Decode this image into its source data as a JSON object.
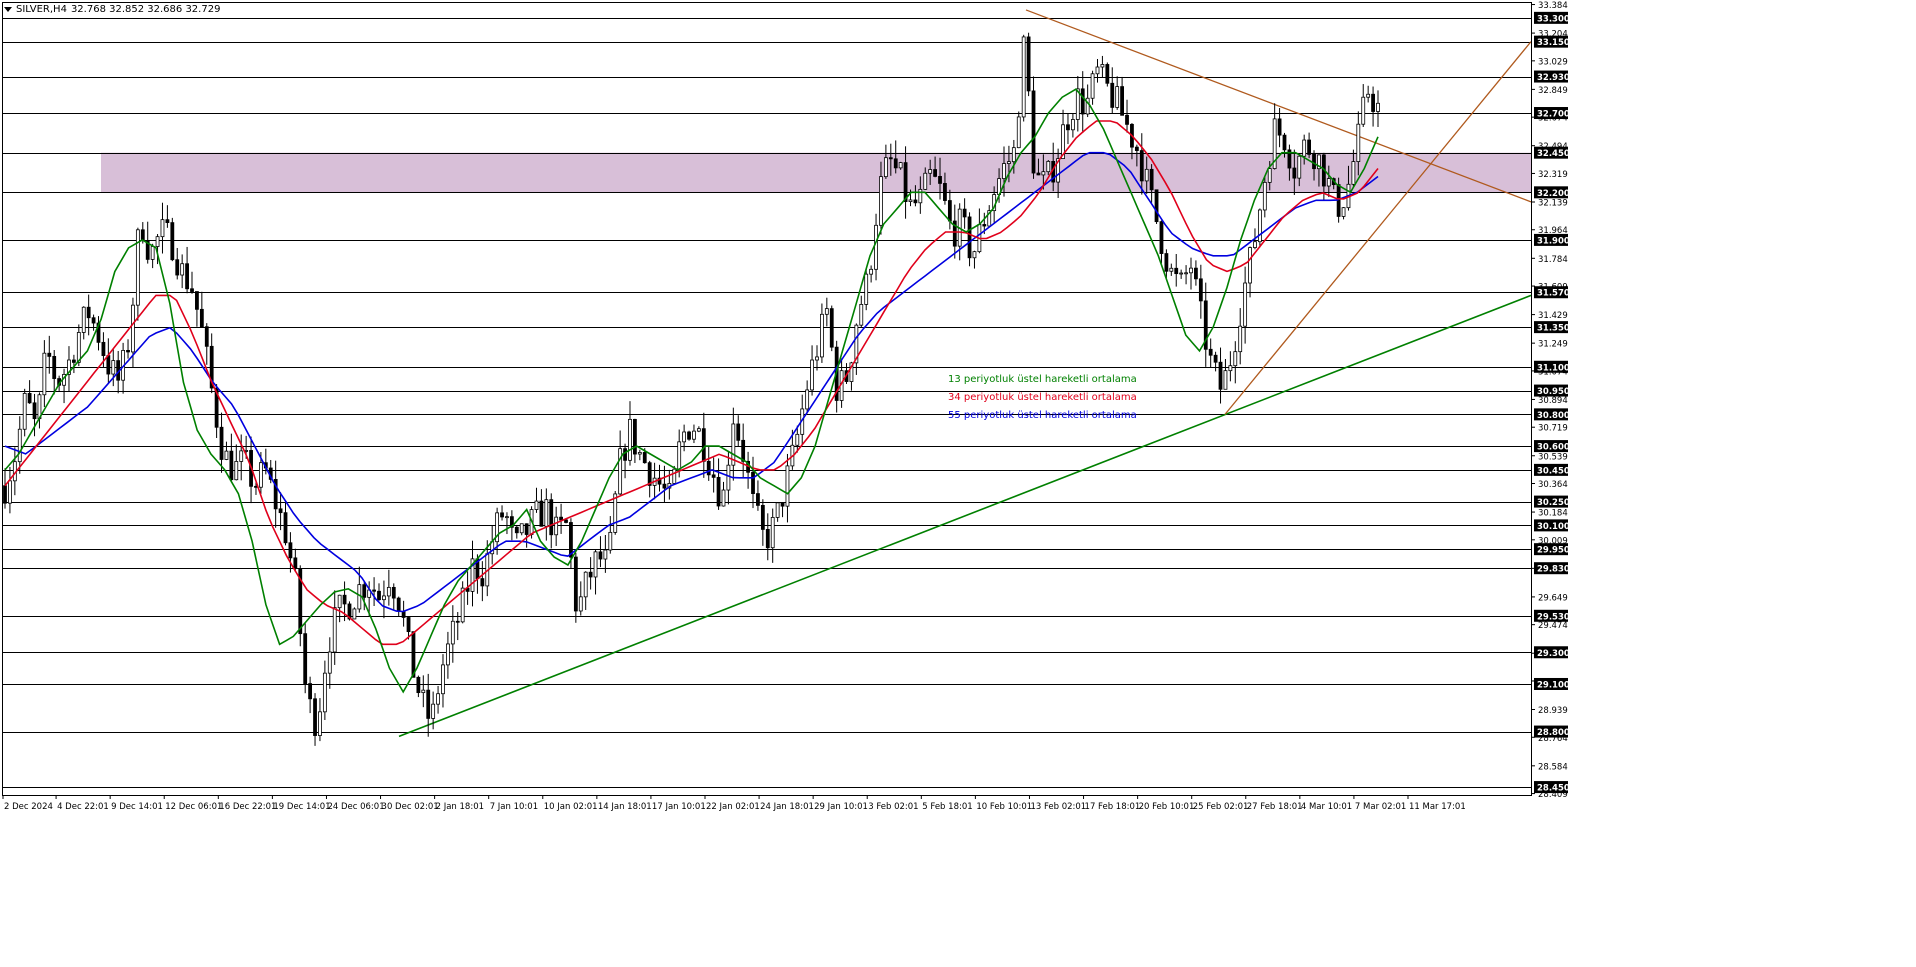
{
  "header": {
    "symbol": "SILVER,H4",
    "ohlc": "32.768 32.852 32.686 32.729"
  },
  "colors": {
    "ema13": "#008000",
    "ema34": "#e0001b",
    "ema55": "#0000e0",
    "support_trend": "#008000",
    "channel_trend": "#b05a1e",
    "zone_fill": "#d8bfd8",
    "hline": "#000000",
    "candle": "#000000"
  },
  "legend": [
    {
      "label": "13 periyotluk üstel hareketli ortalama",
      "color": "#008000"
    },
    {
      "label": "34 periyotluk üstel hareketli ortalama",
      "color": "#e0001b"
    },
    {
      "label": "55 periyotluk üstel hareketli ortalama",
      "color": "#0000e0"
    }
  ],
  "chart_data": {
    "type": "candlestick",
    "ylim": [
      28.4,
      33.4
    ],
    "y_ticks": [
      "33.384",
      "33.204",
      "33.029",
      "32.849",
      "32.674",
      "32.494",
      "32.319",
      "32.139",
      "31.964",
      "31.784",
      "31.609",
      "31.429",
      "31.249",
      "31.074",
      "30.894",
      "30.719",
      "30.539",
      "30.364",
      "30.184",
      "30.009",
      "29.829",
      "29.649",
      "29.474",
      "29.294",
      "29.119",
      "28.939",
      "28.764",
      "28.584",
      "28.409"
    ],
    "x_labels": [
      "2 Dec 2024",
      "4 Dec 22:01",
      "9 Dec 14:01",
      "12 Dec 06:01",
      "16 Dec 22:01",
      "19 Dec 14:01",
      "24 Dec 06:01",
      "30 Dec 02:01",
      "2 Jan 18:01",
      "7 Jan 10:01",
      "10 Jan 02:01",
      "14 Jan 18:01",
      "17 Jan 10:01",
      "22 Jan 02:01",
      "24 Jan 18:01",
      "29 Jan 10:01",
      "3 Feb 02:01",
      "5 Feb 18:01",
      "10 Feb 10:01",
      "13 Feb 02:01",
      "17 Feb 18:01",
      "20 Feb 10:01",
      "25 Feb 02:01",
      "27 Feb 18:01",
      "4 Mar 10:01",
      "7 Mar 02:01",
      "11 Mar 17:01"
    ],
    "price_levels": [
      "33.300",
      "33.150",
      "32.930",
      "32.700",
      "32.450",
      "32.200",
      "31.900",
      "31.570",
      "31.350",
      "31.100",
      "30.950",
      "30.800",
      "30.600",
      "30.450",
      "30.250",
      "30.100",
      "29.950",
      "29.830",
      "29.530",
      "29.300",
      "29.100",
      "28.800",
      "28.450"
    ],
    "zone": {
      "from": 32.2,
      "to": 32.45
    },
    "close_path": [
      30.35,
      30.55,
      30.9,
      30.7,
      31.2,
      31.0,
      31.1,
      31.3,
      31.45,
      31.3,
      31.1,
      31.0,
      31.3,
      32.05,
      31.8,
      31.95,
      31.9,
      31.7,
      31.6,
      31.3,
      30.9,
      30.55,
      30.45,
      30.5,
      30.35,
      30.45,
      30.25,
      30.05,
      29.7,
      29.0,
      28.85,
      29.35,
      29.55,
      29.6,
      29.7,
      29.75,
      29.65,
      29.8,
      29.6,
      29.25,
      29.0,
      28.85,
      29.2,
      29.4,
      29.6,
      29.85,
      29.8,
      30.05,
      30.2,
      29.95,
      30.05,
      30.15,
      30.2,
      30.05,
      30.1,
      29.55,
      29.75,
      29.9,
      29.85,
      30.45,
      30.7,
      30.55,
      30.45,
      30.35,
      30.25,
      30.65,
      30.75,
      30.65,
      30.45,
      30.25,
      30.8,
      30.55,
      30.2,
      30.0,
      30.1,
      30.35,
      30.6,
      30.95,
      31.2,
      31.45,
      30.95,
      31.05,
      31.45,
      31.65,
      32.2,
      32.4,
      32.3,
      32.1,
      32.15,
      32.3,
      32.2,
      31.95,
      32.0,
      31.8,
      32.0,
      32.2,
      32.35,
      32.45,
      33.15,
      32.3,
      32.25,
      32.4,
      32.65,
      32.8,
      32.75,
      32.95,
      32.85,
      32.75,
      32.6,
      32.45,
      32.2,
      31.95,
      31.7,
      31.6,
      31.75,
      31.4,
      31.1,
      30.95,
      31.2,
      31.55,
      31.85,
      32.25,
      32.6,
      32.55,
      32.35,
      32.5,
      32.45,
      32.3,
      32.1,
      32.2,
      32.5,
      32.85,
      32.73
    ],
    "ema13_path": [
      30.45,
      30.55,
      30.7,
      30.85,
      31.0,
      31.1,
      31.2,
      31.4,
      31.7,
      31.85,
      31.9,
      31.85,
      31.5,
      31.0,
      30.7,
      30.55,
      30.45,
      30.3,
      30.0,
      29.6,
      29.35,
      29.4,
      29.5,
      29.6,
      29.68,
      29.7,
      29.65,
      29.45,
      29.2,
      29.05,
      29.2,
      29.4,
      29.6,
      29.75,
      29.85,
      29.95,
      30.05,
      30.1,
      30.2,
      30.0,
      29.9,
      29.85,
      30.0,
      30.2,
      30.4,
      30.55,
      30.6,
      30.55,
      30.5,
      30.45,
      30.5,
      30.6,
      30.6,
      30.55,
      30.5,
      30.4,
      30.35,
      30.3,
      30.4,
      30.6,
      30.9,
      31.2,
      31.5,
      31.8,
      32.0,
      32.1,
      32.2,
      32.2,
      32.1,
      32.0,
      31.95,
      32.0,
      32.1,
      32.3,
      32.45,
      32.55,
      32.7,
      32.8,
      32.85,
      32.75,
      32.6,
      32.4,
      32.2,
      32.0,
      31.8,
      31.55,
      31.3,
      31.2,
      31.35,
      31.6,
      31.9,
      32.15,
      32.35,
      32.45,
      32.45,
      32.4,
      32.35,
      32.25,
      32.2,
      32.35,
      32.55
    ],
    "ema34_path": [
      30.35,
      30.5,
      30.65,
      30.8,
      30.95,
      31.1,
      31.25,
      31.4,
      31.55,
      31.55,
      31.3,
      31.0,
      30.75,
      30.5,
      30.15,
      29.9,
      29.7,
      29.6,
      29.55,
      29.45,
      29.35,
      29.35,
      29.45,
      29.55,
      29.65,
      29.75,
      29.85,
      29.95,
      30.05,
      30.1,
      30.15,
      30.2,
      30.25,
      30.3,
      30.35,
      30.4,
      30.45,
      30.5,
      30.55,
      30.5,
      30.45,
      30.45,
      30.55,
      30.7,
      30.9,
      31.1,
      31.3,
      31.5,
      31.7,
      31.85,
      31.95,
      31.95,
      31.9,
      31.95,
      32.05,
      32.2,
      32.4,
      32.55,
      32.65,
      32.65,
      32.55,
      32.4,
      32.2,
      31.95,
      31.75,
      31.7,
      31.75,
      31.9,
      32.05,
      32.15,
      32.2,
      32.15,
      32.2,
      32.35
    ],
    "ema55_path": [
      30.6,
      30.55,
      30.65,
      30.75,
      30.85,
      31.0,
      31.15,
      31.3,
      31.35,
      31.2,
      31.0,
      30.85,
      30.6,
      30.35,
      30.15,
      30.0,
      29.9,
      29.8,
      29.6,
      29.55,
      29.6,
      29.7,
      29.8,
      29.9,
      30.0,
      30.0,
      29.95,
      29.9,
      30.0,
      30.1,
      30.15,
      30.25,
      30.35,
      30.4,
      30.45,
      30.4,
      30.4,
      30.5,
      30.7,
      30.9,
      31.1,
      31.3,
      31.45,
      31.55,
      31.65,
      31.75,
      31.85,
      31.95,
      32.05,
      32.15,
      32.25,
      32.35,
      32.45,
      32.45,
      32.35,
      32.15,
      31.95,
      31.85,
      31.8,
      31.8,
      31.9,
      32.0,
      32.1,
      32.15,
      32.15,
      32.2,
      32.3
    ]
  }
}
